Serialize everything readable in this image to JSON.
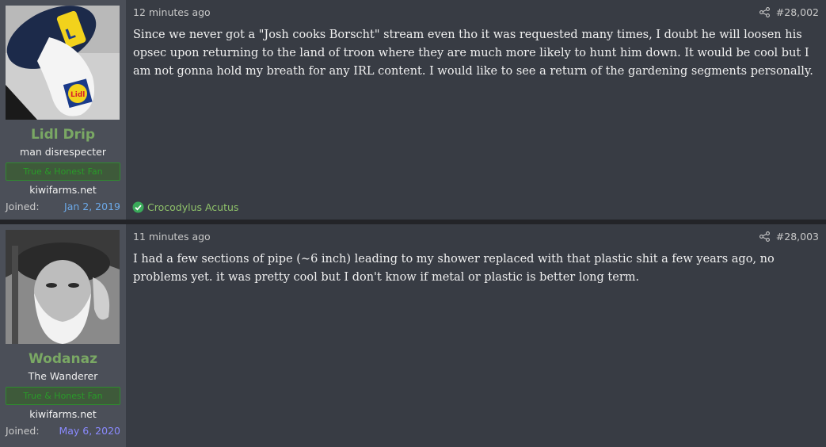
{
  "posts": [
    {
      "username": "Lidl Drip",
      "user_title": "man disrespecter",
      "banner": "True & Honest Fan",
      "site": "kiwifarms.net",
      "joined_label": "Joined:",
      "joined_date": "Jan 2, 2019",
      "time": "12 minutes ago",
      "post_number": "#28,002",
      "body": "Since we never got a \"Josh cooks Borscht\" stream even tho it was requested many times, I doubt he will loosen his opsec upon returning to the land of troon where they are much more likely to hunt him down. It would be cool but I am not gonna hold my breath for any IRL content. I would like to see a return of the gardening segments personally.",
      "reaction": "Crocodylus Acutus"
    },
    {
      "username": "Wodanaz",
      "user_title": "The Wanderer",
      "banner": "True & Honest Fan",
      "site": "kiwifarms.net",
      "joined_label": "Joined:",
      "joined_date": "May 6, 2020",
      "time": "11 minutes ago",
      "post_number": "#28,003",
      "body": "I had a few sections of pipe (~6 inch) leading to my shower replaced with that plastic shit a few years ago, no problems yet. it was pretty cool but I don't know if metal or plastic is better long term."
    }
  ],
  "colors": {
    "username": "#7aa864",
    "banner_text": "#2a9a2a",
    "reaction": "#8fc26a",
    "check_badge": "#3aaa5a"
  },
  "icons": [
    "share-icon",
    "checkmark-icon"
  ]
}
